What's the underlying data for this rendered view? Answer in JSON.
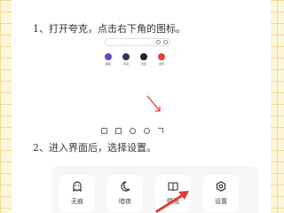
{
  "steps": [
    "1、打开夸克，点击右下角的图标。",
    "2、进入界面后，选择设置。"
  ],
  "screenshot_apps": [
    {
      "label": "图库",
      "icon": "purple-circle-icon",
      "color": "#6b45c9"
    },
    {
      "label": "夸克",
      "icon": "dark-circle-icon",
      "color": "#2b3c5a"
    },
    {
      "label": "社区",
      "icon": "dark-circle-icon",
      "color": "#222222"
    },
    {
      "label": "发现",
      "icon": "red-circle-icon",
      "color": "#d9463a"
    }
  ],
  "tiles": [
    {
      "label": "无痕",
      "icon": "ghost-icon"
    },
    {
      "label": "暗夜",
      "icon": "moon-icon"
    },
    {
      "label": "壁纸",
      "icon": "book-icon"
    },
    {
      "label": "设置",
      "icon": "settings-icon"
    }
  ],
  "colors": {
    "arrow": "#e53935",
    "background_grid": "#f0d898",
    "background": "#fdf6d8"
  }
}
